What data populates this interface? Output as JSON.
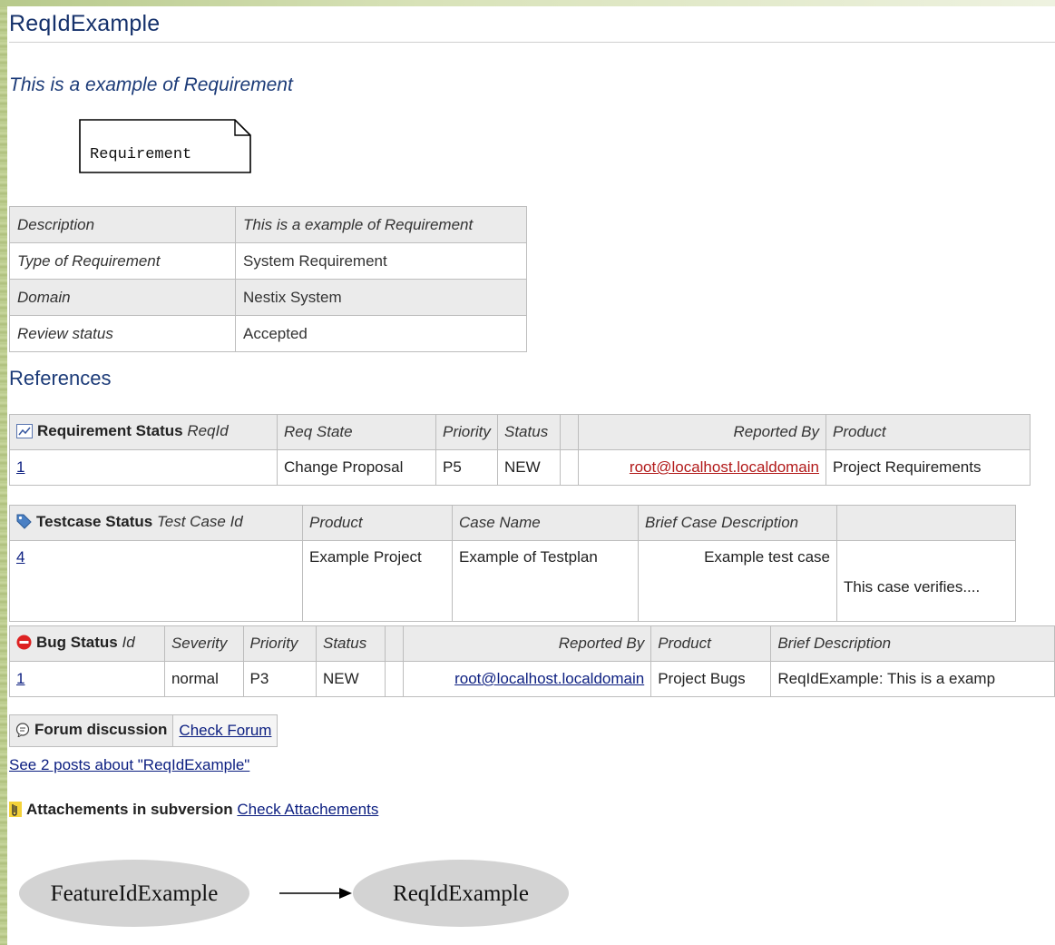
{
  "page": {
    "title": "ReqIdExample",
    "subtitle": "This is a example of Requirement",
    "box_label": "Requirement"
  },
  "properties": [
    {
      "key": "Description",
      "value": "This is a example of Requirement"
    },
    {
      "key": "Type of Requirement",
      "value": "System Requirement"
    },
    {
      "key": "Domain",
      "value": "Nestix System"
    },
    {
      "key": "Review status",
      "value": "Accepted"
    }
  ],
  "references_heading": "References",
  "requirement_status": {
    "title": "Requirement Status",
    "id_label": "ReqId",
    "headers": [
      "Req State",
      "Priority",
      "Status",
      "",
      "Reported By",
      "Product"
    ],
    "row": {
      "id": "1",
      "state": "Change Proposal",
      "priority": "P5",
      "status": "NEW",
      "blank": "",
      "reporter": "root@localhost.localdomain",
      "product": "Project Requirements"
    },
    "icon": "chart-icon"
  },
  "testcase_status": {
    "title": "Testcase Status",
    "id_label": "Test Case Id",
    "headers": [
      "Product",
      "Case Name",
      "Brief Case Description",
      ""
    ],
    "row": {
      "id": "4",
      "product": "Example Project",
      "case_name": "Example of Testplan",
      "description": "Example test case",
      "extra": "This case verifies...."
    },
    "icon": "tag-icon"
  },
  "bug_status": {
    "title": "Bug Status",
    "id_label": "Id",
    "headers": [
      "Severity",
      "Priority",
      "Status",
      "",
      "Reported By",
      "Product",
      "Brief Description"
    ],
    "row": {
      "id": "1",
      "severity": "normal",
      "priority": "P3",
      "status": "NEW",
      "blank": "",
      "reporter": "root@localhost.localdomain",
      "product": "Project Bugs",
      "description": "ReqIdExample: This is a examp"
    },
    "icon": "stop-icon"
  },
  "forum": {
    "title": "Forum discussion",
    "link": "Check Forum",
    "posts_link": "See 2 posts about \"ReqIdExample\"",
    "icon": "speech-bubble-icon"
  },
  "attachments": {
    "title": "Attachements in subversion",
    "link": "Check Attachements",
    "icon": "paperclip-icon"
  },
  "graph": {
    "from": "FeatureIdExample",
    "to": "ReqIdExample"
  },
  "colors": {
    "heading": "#15316b",
    "link": "#0b1e80",
    "reporter_link": "#b21a1a",
    "header_bg": "#ebebeb",
    "node_fill": "#d3d3d3"
  }
}
